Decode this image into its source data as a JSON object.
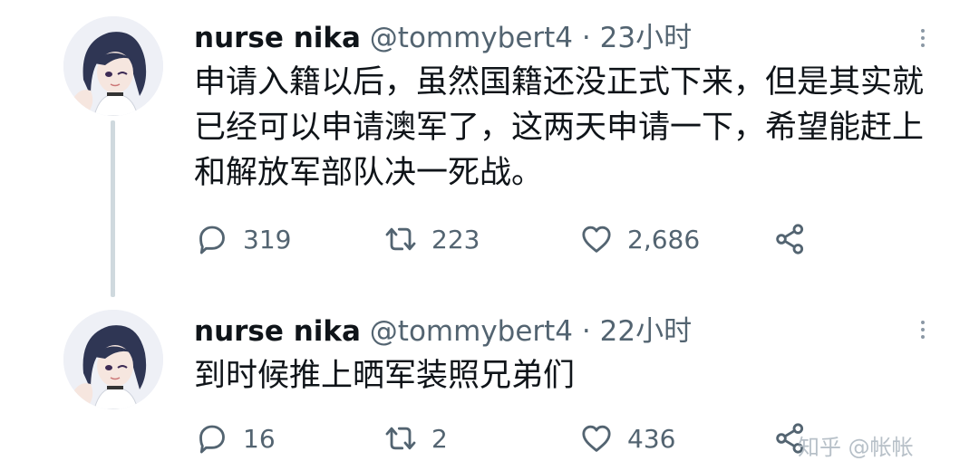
{
  "tweets": [
    {
      "name": "nurse nika",
      "handle": "@tommybert4",
      "separator": "·",
      "time": "23小时",
      "text": "申请入籍以后，虽然国籍还没正式下来，但是其实就已经可以申请澳军了，这两天申请一下，希望能赶上和解放军部队决一死战。",
      "replies": "319",
      "retweets": "223",
      "likes": "2,686"
    },
    {
      "name": "nurse nika",
      "handle": "@tommybert4",
      "separator": "·",
      "time": "22小时",
      "text": "到时候推上晒军装照兄弟们",
      "replies": "16",
      "retweets": "2",
      "likes": "436"
    }
  ],
  "watermark": "知乎 @帐帐",
  "icons": {
    "reply": "reply-icon",
    "retweet": "retweet-icon",
    "like": "heart-icon",
    "share": "share-icon",
    "more": "more-icon"
  },
  "colors": {
    "text": "#0f1419",
    "secondary": "#536471",
    "thread_line": "#cfd9de"
  }
}
